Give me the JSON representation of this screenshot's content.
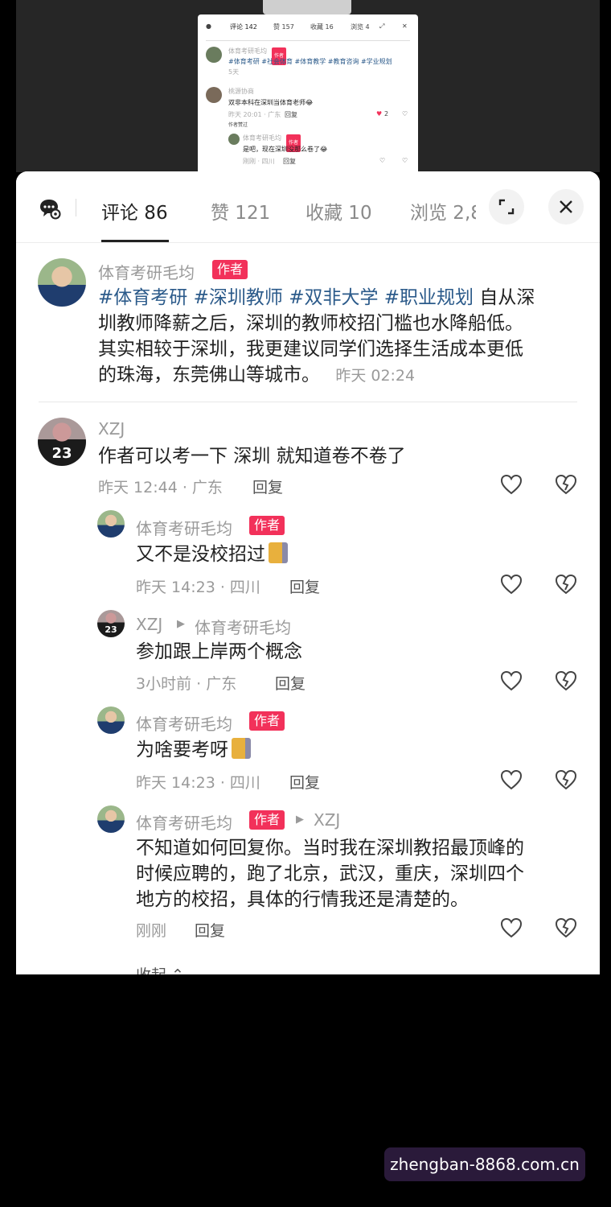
{
  "preview": {
    "tabs": [
      "评论 142",
      "赞 157",
      "收藏 16",
      "浏览 4"
    ],
    "author_name": "体育考研毛均",
    "author_badge": "作者",
    "post_tags": "#体育考研 #社会体育 #体育教学 #教育咨询 #学业规划",
    "post_time": "5天",
    "comment_name": "桃源协商",
    "comment_text": "双非本科在深圳当体育老师😂",
    "comment_meta": "昨天 20:01 · 广东",
    "comment_reply": "回复",
    "comment_likes": "2",
    "comment_expand": "作者赞过",
    "reply_name": "体育考研毛均",
    "reply_badge": "作者",
    "reply_text": "是吧，现在深圳没那么卷了😂",
    "reply_meta": "刚刚 · 四川",
    "reply_reply": "回复"
  },
  "header": {
    "tabs": [
      "评论 86",
      "赞 121",
      "收藏 10",
      "浏览 2,8"
    ],
    "active_tab": 0,
    "icons": [
      "comment-settings-icon",
      "expand-icon",
      "close-icon"
    ]
  },
  "post": {
    "author": "体育考研毛均",
    "badge": "作者",
    "tags": [
      "#体育考研",
      "#深圳教师",
      "#双非大学",
      "#职业规划"
    ],
    "text_line1_rest": "自从深",
    "text_lines": [
      "圳教师降薪之后，深圳的教师校招门槛也水降船低。",
      "其实相较于深圳，我更建议同学们选择生活成本更低",
      "的珠海，东莞佛山等城市。"
    ],
    "time": "昨天 02:24"
  },
  "comments": [
    {
      "name": "XZJ",
      "text": "作者可以考一下 深圳 就知道卷不卷了",
      "meta": "昨天 12:44 · 广东",
      "reply": "回复"
    },
    {
      "name": "体育考研毛均",
      "badge": "作者",
      "text": "又不是没校招过",
      "meta": "昨天 14:23 · 四川",
      "reply": "回复"
    },
    {
      "name": "XZJ",
      "target": "体育考研毛均",
      "text": "参加跟上岸两个概念",
      "meta": "3小时前 · 广东",
      "reply": "回复"
    },
    {
      "name": "体育考研毛均",
      "badge": "作者",
      "text": "为啥要考呀",
      "meta": "昨天 14:23 · 四川",
      "reply": "回复"
    },
    {
      "name": "体育考研毛均",
      "badge": "作者",
      "target": "XZJ",
      "text_lines": [
        "不知道如何回复你。当时我在深圳教招最顶峰的",
        "时候应聘的，跑了北京，武汉，重庆，深圳四个",
        "地方的校招，具体的行情我还是清楚的。"
      ],
      "meta": "刚刚",
      "reply": "回复"
    }
  ],
  "collapse": "收起 ⌃",
  "avatar_numbers": {
    "xzj": "23"
  },
  "watermark": "zhengban-8868.com.cn",
  "colors": {
    "accent_badge": "#f2315a",
    "hashtag": "#2b5a8a",
    "meta": "#9a9a9a"
  }
}
